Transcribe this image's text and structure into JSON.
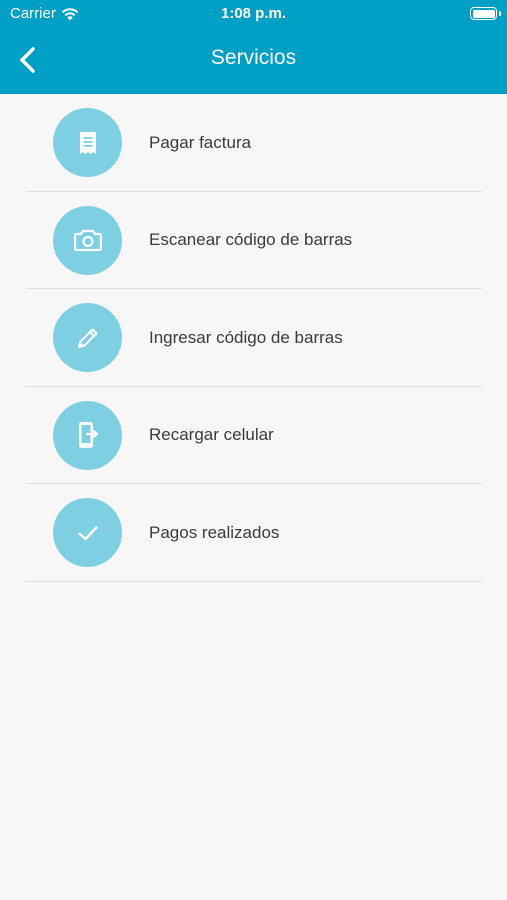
{
  "status_bar": {
    "carrier": "Carrier",
    "time": "1:08 p.m."
  },
  "nav": {
    "title": "Servicios",
    "back_icon": "chevron-left-icon"
  },
  "colors": {
    "header": "#00a0c6",
    "icon_circle": "#7fcfe3",
    "background": "#f7f7f7"
  },
  "services": [
    {
      "label": "Pagar factura",
      "icon": "invoice-icon"
    },
    {
      "label": "Escanear código de barras",
      "icon": "camera-icon"
    },
    {
      "label": "Ingresar código de barras",
      "icon": "pencil-icon"
    },
    {
      "label": "Recargar celular",
      "icon": "phone-recharge-icon"
    },
    {
      "label": "Pagos realizados",
      "icon": "checkmark-icon"
    }
  ]
}
